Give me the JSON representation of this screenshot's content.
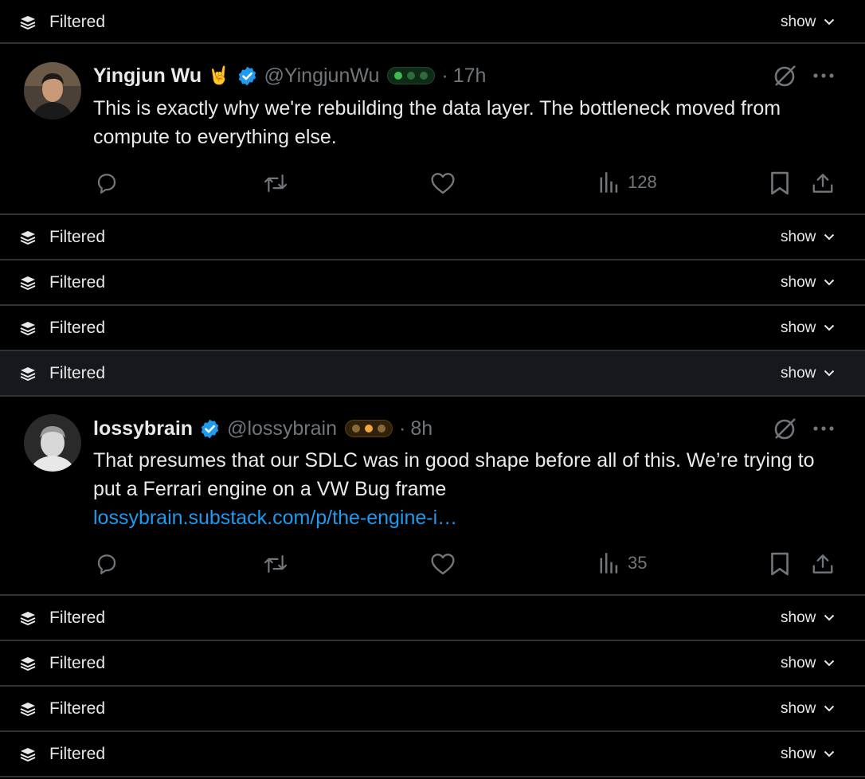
{
  "filtered_rows": [
    {
      "label": "Filtered",
      "action": "show"
    },
    {
      "label": "Filtered",
      "action": "show"
    },
    {
      "label": "Filtered",
      "action": "show"
    },
    {
      "label": "Filtered",
      "action": "show"
    },
    {
      "label": "Filtered",
      "action": "show"
    },
    {
      "label": "Filtered",
      "action": "show"
    },
    {
      "label": "Filtered",
      "action": "show"
    },
    {
      "label": "Filtered",
      "action": "show"
    },
    {
      "label": "Filtered",
      "action": "show"
    }
  ],
  "tweets": [
    {
      "name": "Yingjun Wu",
      "emoji": "🤘",
      "handle": "@YingjunWu",
      "badge_color": "#3fb950",
      "separator": "·",
      "time": "17h",
      "text": "This is exactly why we're rebuilding the data layer. The bottleneck moved from compute to everything else.",
      "link": "",
      "views": "128"
    },
    {
      "name": "lossybrain",
      "emoji": "",
      "handle": "@lossybrain",
      "badge_color": "#f0a83c",
      "separator": "·",
      "time": "8h",
      "text": "That presumes that our SDLC was in good shape before all of this. We’re trying to put a Ferrari engine on a VW Bug frame",
      "link": "lossybrain.substack.com/p/the-engine-i…",
      "views": "35"
    }
  ],
  "colors": {
    "verified": "#1d9bf0",
    "link": "#1d9bf0",
    "muted": "#71767b"
  },
  "icons": [
    "stack-icon",
    "chevron-down-icon",
    "verified-badge-icon",
    "grok-icon",
    "more-icon",
    "reply-icon",
    "retweet-icon",
    "like-icon",
    "views-icon",
    "bookmark-icon",
    "share-icon"
  ]
}
